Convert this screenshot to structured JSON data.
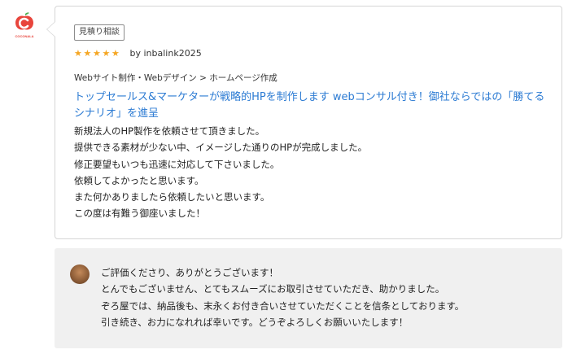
{
  "logo": {
    "icon": "apple-c-logo-icon",
    "text": "COCONALA"
  },
  "review": {
    "badge": "見積り相談",
    "stars": [
      "★",
      "★",
      "★",
      "★",
      "★"
    ],
    "rating": 5,
    "byline": "by inbalink2025",
    "category": "Webサイト制作・Webデザイン > ホームページ作成",
    "service_title": "トップセールス&マーケターが戦略的HPを制作します webコンサル付き！御社ならではの「勝てるシナリオ」を進呈",
    "body": [
      "新規法人のHP製作を依頼させて頂きました。",
      "提供できる素材が少ない中、イメージした通りのHPが完成しました。",
      "修正要望もいつも迅速に対応して下さいました。",
      "依頼してよかったと思います。",
      "また何かありましたら依頼したいと思います。",
      "この度は有難う御座いました！"
    ]
  },
  "reply": {
    "avatar_icon": "seller-avatar",
    "body": [
      "ご評価くださり、ありがとうございます！",
      "とんでもございません、とてもスムーズにお取引させていただき、助かりました。",
      "ぞろ屋では、納品後も、末永くお付き合いさせていただくことを信条としております。",
      "引き続き、お力になれれば幸いです。どうぞよろしくお願いいたします！"
    ]
  },
  "colors": {
    "star": "#f5a623",
    "link": "#2c7bd3",
    "reply_bg": "#f0f0f0",
    "logo_red": "#e8453c"
  }
}
